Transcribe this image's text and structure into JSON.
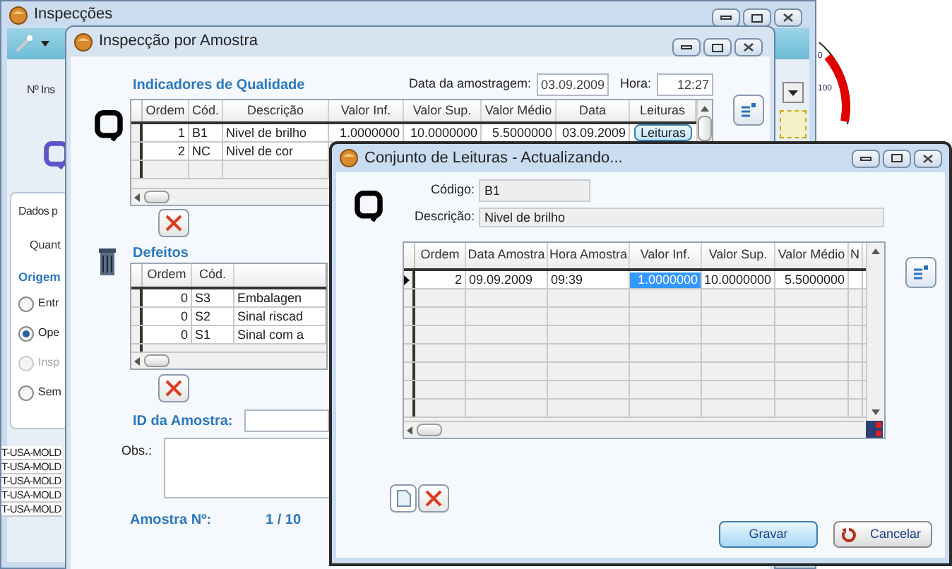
{
  "desktop": {
    "gauge_labels": [
      "0",
      "100"
    ]
  },
  "main_window": {
    "title": "Inspecções",
    "field_label": "Nº Ins",
    "panel_title": "Dados p",
    "quantity_label": "Quant",
    "origin_label": "Origem",
    "origin_options": [
      {
        "label": "Entr",
        "selected": false,
        "disabled": false
      },
      {
        "label": "Ope",
        "selected": true,
        "disabled": false
      },
      {
        "label": "Insp",
        "selected": false,
        "disabled": true
      },
      {
        "label": "Sem",
        "selected": false,
        "disabled": false
      }
    ],
    "list_rows": [
      "T-USA-MOLD",
      "T-USA-MOLD",
      "T-USA-MOLD",
      "T-USA-MOLD",
      "T-USA-MOLD"
    ]
  },
  "sample_window": {
    "title": "Inspecção por Amostra",
    "date_label": "Data da amostragem:",
    "date_value": "03.09.2009",
    "time_label": "Hora:",
    "time_value": "12:27",
    "indicators": {
      "title": "Indicadores de Qualidade",
      "columns": [
        "Ordem",
        "Cód.",
        "Descrição",
        "Valor Inf.",
        "Valor Sup.",
        "Valor Médio",
        "Data",
        "Leituras"
      ],
      "rows": [
        {
          "cells": [
            "1",
            "B1",
            "Nivel de brilho",
            "1.0000000",
            "10.0000000",
            "5.5000000",
            "03.09.2009"
          ],
          "button": "Leituras"
        },
        {
          "cells": [
            "2",
            "NC",
            "Nivel de cor"
          ]
        }
      ]
    },
    "defects": {
      "title": "Defeitos",
      "columns": [
        "Ordem",
        "Cód."
      ],
      "rows": [
        {
          "cells": [
            "0",
            "S3",
            "Embalagen"
          ]
        },
        {
          "cells": [
            "0",
            "S2",
            "Sinal riscad"
          ]
        },
        {
          "cells": [
            "0",
            "S1",
            "Sinal com a"
          ]
        }
      ]
    },
    "id_label": "ID da Amostra:",
    "obs_label": "Obs.:",
    "sample_no_label": "Amostra Nº:",
    "sample_no_value": "1 / 10"
  },
  "readings_window": {
    "title": "Conjunto de Leituras - Actualizando...",
    "code_label": "Código:",
    "code_value": "B1",
    "description_label": "Descrição:",
    "description_value": "Nivel de brilho",
    "columns": [
      "Ordem",
      "Data Amostra",
      "Hora Amostra",
      "Valor Inf.",
      "Valor Sup.",
      "Valor Médio",
      "N"
    ],
    "rows": [
      {
        "current": true,
        "cells": [
          {
            "text": "2",
            "selected": false
          },
          {
            "text": "09.09.2009",
            "selected": false
          },
          {
            "text": "09:39",
            "selected": false
          },
          {
            "text": "1.0000000",
            "selected": true
          },
          {
            "text": "10.0000000",
            "selected": false
          },
          {
            "text": "5.5000000",
            "selected": false
          }
        ]
      }
    ],
    "buttons": [
      {
        "kind": "primary",
        "label": "Gravar"
      },
      {
        "kind": "cancel",
        "label": "Cancelar"
      }
    ]
  }
}
